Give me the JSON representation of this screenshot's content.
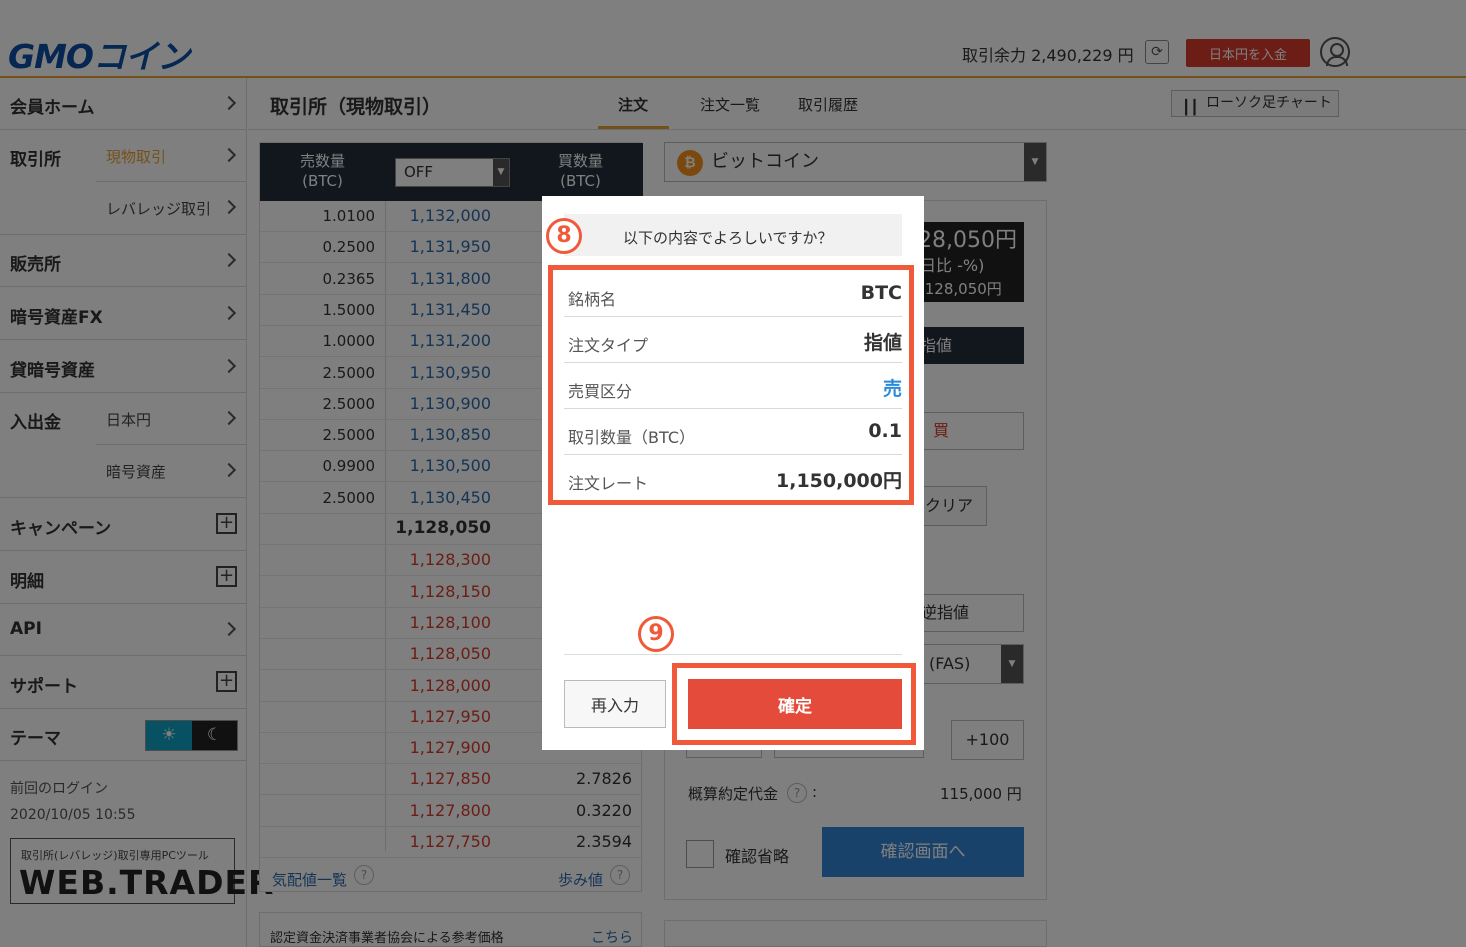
{
  "header": {
    "logo": "GMOコイン",
    "margin_label": "取引余力 2,490,229 円",
    "deposit_button": "日本円を入金"
  },
  "sidebar": {
    "items": [
      {
        "label": "会員ホーム"
      },
      {
        "label": "取引所",
        "sub": "現物取引"
      },
      {
        "sub": "レバレッジ取引"
      },
      {
        "label": "販売所"
      },
      {
        "label": "暗号資産FX"
      },
      {
        "label": "貸暗号資産"
      },
      {
        "label": "入出金",
        "sub": "日本円"
      },
      {
        "sub": "暗号資産"
      },
      {
        "label": "キャンペーン"
      },
      {
        "label": "明細"
      },
      {
        "label": "API"
      },
      {
        "label": "サポート"
      },
      {
        "label": "テーマ"
      }
    ],
    "last_login_label": "前回のログイン",
    "last_login_time": "2020/10/05 10:55",
    "webtrader_caption": "取引所(レバレッジ)取引専用PCツール",
    "webtrader_logo": "WEB.TRADER"
  },
  "main": {
    "title": "取引所（現物取引）",
    "tabs": [
      {
        "label": "注文"
      },
      {
        "label": "注文一覧"
      },
      {
        "label": "取引履歴"
      }
    ],
    "candle_button": "ローソク足チャート"
  },
  "orderbook": {
    "sell_header": "売数量\n(BTC)",
    "buy_header": "買数量\n(BTC)",
    "filter_value": "OFF",
    "asks": [
      {
        "qty": "1.0100",
        "price": "1,132,000"
      },
      {
        "qty": "0.2500",
        "price": "1,131,950"
      },
      {
        "qty": "0.2365",
        "price": "1,131,800"
      },
      {
        "qty": "1.5000",
        "price": "1,131,450"
      },
      {
        "qty": "1.0000",
        "price": "1,131,200"
      },
      {
        "qty": "2.5000",
        "price": "1,130,950"
      },
      {
        "qty": "2.5000",
        "price": "1,130,900"
      },
      {
        "qty": "2.5000",
        "price": "1,130,850"
      },
      {
        "qty": "0.9900",
        "price": "1,130,500"
      },
      {
        "qty": "2.5000",
        "price": "1,130,450"
      }
    ],
    "mid_price": "1,128,050",
    "bids": [
      {
        "price": "1,128,300",
        "qty": ""
      },
      {
        "price": "1,128,150",
        "qty": ""
      },
      {
        "price": "1,128,100",
        "qty": ""
      },
      {
        "price": "1,128,050",
        "qty": ""
      },
      {
        "price": "1,128,000",
        "qty": ""
      },
      {
        "price": "1,127,950",
        "qty": ""
      },
      {
        "price": "1,127,900",
        "qty": ""
      },
      {
        "price": "1,127,850",
        "qty": "2.7826"
      },
      {
        "price": "1,127,800",
        "qty": "0.3220"
      },
      {
        "price": "1,127,750",
        "qty": "2.3594"
      }
    ],
    "footer_left": "気配値一覧",
    "footer_right": "歩み値",
    "reference_text": "認定資金決済事業者協会による参考価格",
    "reference_link": "こちら"
  },
  "order_panel": {
    "coin": "ビットコイン",
    "price_big": "28,050円",
    "price_change": "日比 -%)",
    "price_prev": ",128,050円",
    "type_button": "指値",
    "buy_button": "買",
    "clear_button": "クリア",
    "stop_button": "逆指値",
    "fas_value": "(FAS)",
    "plus100": "+100",
    "estimate_label": "概算約定代金",
    "estimate_value": "115,000 円",
    "skip_label": "確認省略",
    "confirm_screen_button": "確認画面へ"
  },
  "modal": {
    "step_8": "8",
    "step_9": "9",
    "title": "以下の内容でよろしいですか？",
    "rows": [
      {
        "label": "銘柄名",
        "value": "BTC"
      },
      {
        "label": "注文タイプ",
        "value": "指値"
      },
      {
        "label": "売買区分",
        "value": "売"
      },
      {
        "label": "取引数量（BTC）",
        "value": "0.1"
      },
      {
        "label": "注文レート",
        "value": "1,150,000円"
      }
    ],
    "reenter_button": "再入力",
    "confirm_button": "確定"
  },
  "colors": {
    "accent_orange": "#e9a235",
    "highlight_red": "#f05a3a",
    "confirm_red": "#e54b3a",
    "ask_blue": "#2b6aab",
    "bid_red": "#d93a2b",
    "sell_blue": "#2b8ad6"
  }
}
